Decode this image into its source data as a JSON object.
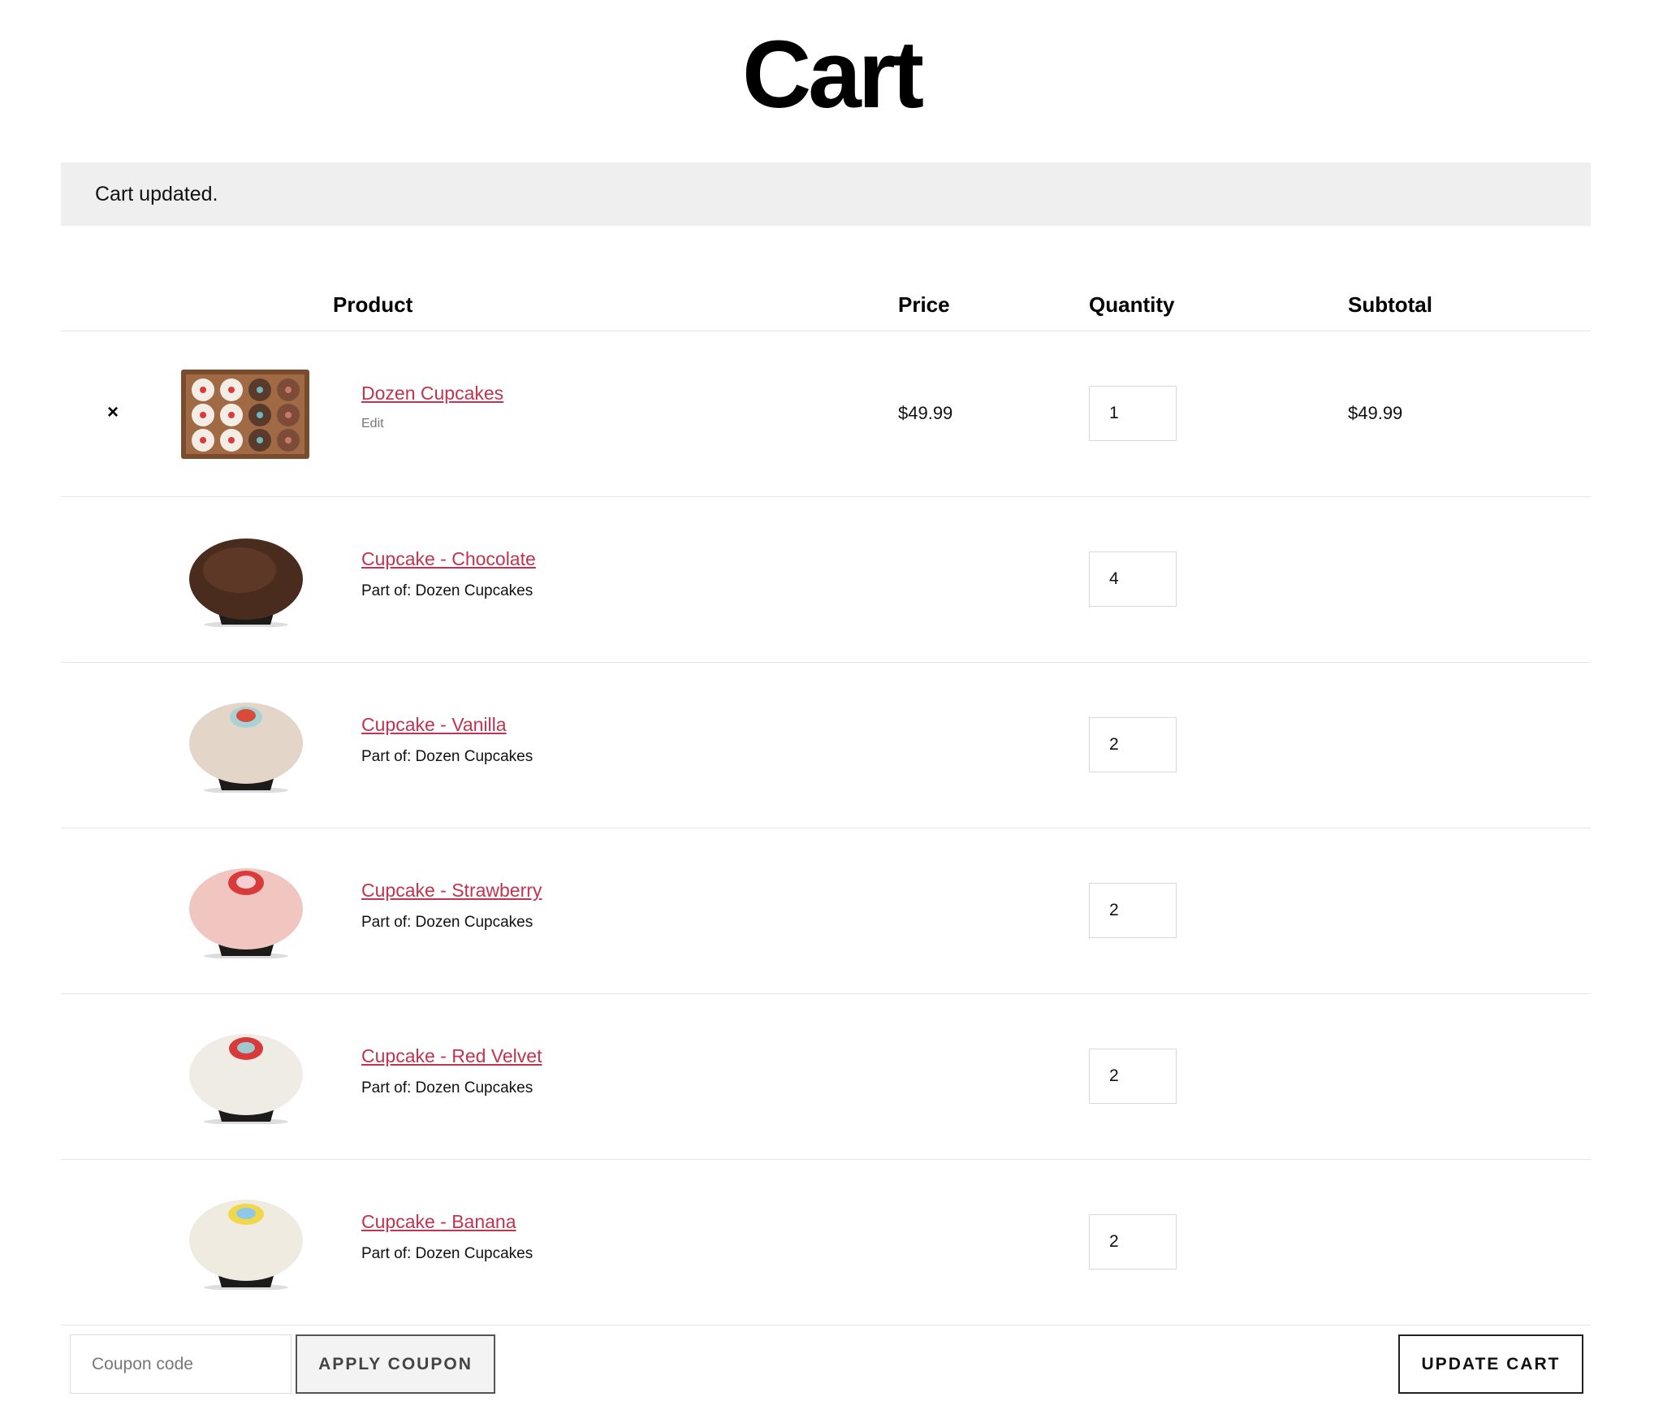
{
  "page": {
    "title": "Cart"
  },
  "notice": {
    "message": "Cart updated."
  },
  "table": {
    "headers": {
      "product": "Product",
      "price": "Price",
      "quantity": "Quantity",
      "subtotal": "Subtotal"
    },
    "remove_symbol": "×",
    "bundle": {
      "name": "Dozen Cupcakes",
      "edit_label": "Edit",
      "price": "$49.99",
      "quantity": "1",
      "subtotal": "$49.99"
    },
    "items": [
      {
        "name": "Cupcake - Chocolate",
        "part_of": "Part of: Dozen Cupcakes",
        "quantity": "4"
      },
      {
        "name": "Cupcake - Vanilla",
        "part_of": "Part of: Dozen Cupcakes",
        "quantity": "2"
      },
      {
        "name": "Cupcake - Strawberry",
        "part_of": "Part of: Dozen Cupcakes",
        "quantity": "2"
      },
      {
        "name": "Cupcake - Red Velvet",
        "part_of": "Part of: Dozen Cupcakes",
        "quantity": "2"
      },
      {
        "name": "Cupcake - Banana",
        "part_of": "Part of: Dozen Cupcakes",
        "quantity": "2"
      }
    ]
  },
  "actions": {
    "coupon_placeholder": "Coupon code",
    "apply_label": "APPLY COUPON",
    "update_label": "UPDATE CART"
  },
  "colors": {
    "link": "#c0344f",
    "notice_bg": "#efefef"
  }
}
